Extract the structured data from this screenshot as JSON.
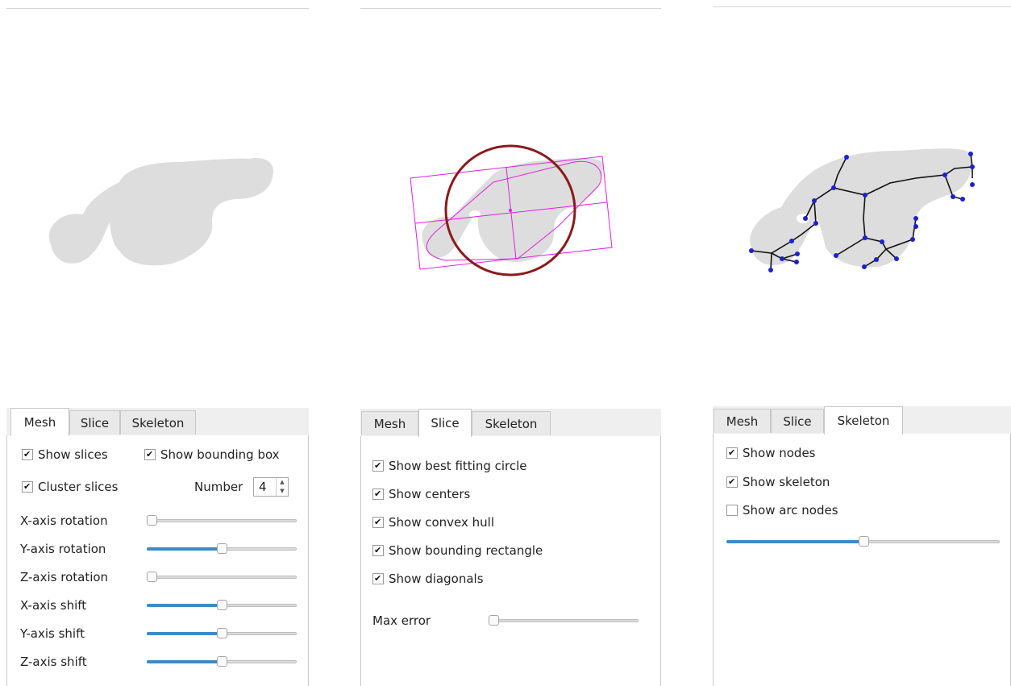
{
  "tabs": [
    "Mesh",
    "Slice",
    "Skeleton"
  ],
  "mesh_panel": {
    "active_tab": "Mesh",
    "show_slices": {
      "label": "Show slices",
      "checked": true
    },
    "show_bounding_box": {
      "label": "Show bounding box",
      "checked": true
    },
    "cluster_slices": {
      "label": "Cluster slices",
      "checked": true
    },
    "number": {
      "label": "Number",
      "value": "4"
    },
    "sliders": [
      {
        "label": "X-axis rotation",
        "value": 0.0
      },
      {
        "label": "Y-axis rotation",
        "value": 0.5
      },
      {
        "label": "Z-axis rotation",
        "value": 0.0
      },
      {
        "label": "X-axis shift",
        "value": 0.5
      },
      {
        "label": "Y-axis shift",
        "value": 0.5
      },
      {
        "label": "Z-axis shift",
        "value": 0.5
      }
    ]
  },
  "slice_panel": {
    "active_tab": "Slice",
    "options": [
      {
        "label": "Show best fitting circle",
        "checked": true
      },
      {
        "label": "Show centers",
        "checked": true
      },
      {
        "label": "Show convex hull",
        "checked": true
      },
      {
        "label": "Show bounding rectangle",
        "checked": true
      },
      {
        "label": "Show diagonals",
        "checked": true
      }
    ],
    "max_error": {
      "label": "Max error",
      "value": 0.0
    }
  },
  "skeleton_panel": {
    "active_tab": "Skeleton",
    "options": [
      {
        "label": "Show nodes",
        "checked": true
      },
      {
        "label": "Show skeleton",
        "checked": true
      },
      {
        "label": "Show arc nodes",
        "checked": false
      }
    ],
    "slider": {
      "value": 0.5
    }
  },
  "colors": {
    "shape_fill": "#dddddd",
    "circle": "#8b1a1a",
    "rectangle": "#e020e0",
    "nodes": "#1a22d0",
    "skeleton": "#111111",
    "slider_fill": "#3d8ac7"
  }
}
